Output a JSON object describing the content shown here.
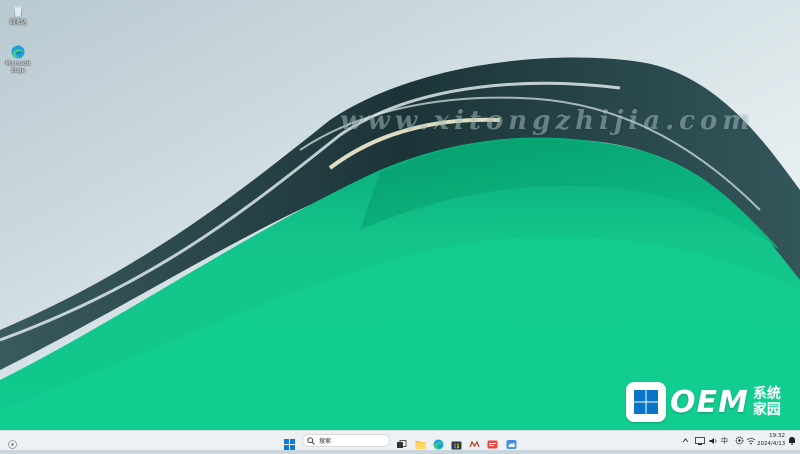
{
  "desktop": {
    "icons": [
      {
        "label": "回收站",
        "icon": "recycle-bin-icon"
      },
      {
        "label": "Microsoft Edge",
        "icon": "edge-icon"
      }
    ],
    "watermark": "www.xitongzhijia.com"
  },
  "branding": {
    "logo_text": "OEM",
    "logo_cn": "系统家园"
  },
  "taskbar": {
    "search_placeholder": "搜索",
    "pinned_apps": [
      "file-explorer-icon",
      "edge-icon",
      "store-icon",
      "widgets-icon",
      "app-red-icon",
      "app-blue-icon"
    ],
    "tray": {
      "ime_label": "中",
      "time": "19:32",
      "date": "2024/4/13"
    }
  },
  "colors": {
    "wallpaper_green": "#16c98c",
    "wallpaper_sky": "#c9d6dc",
    "taskbar_bg": "#eef1f3",
    "accent_blue": "#0067c0"
  }
}
